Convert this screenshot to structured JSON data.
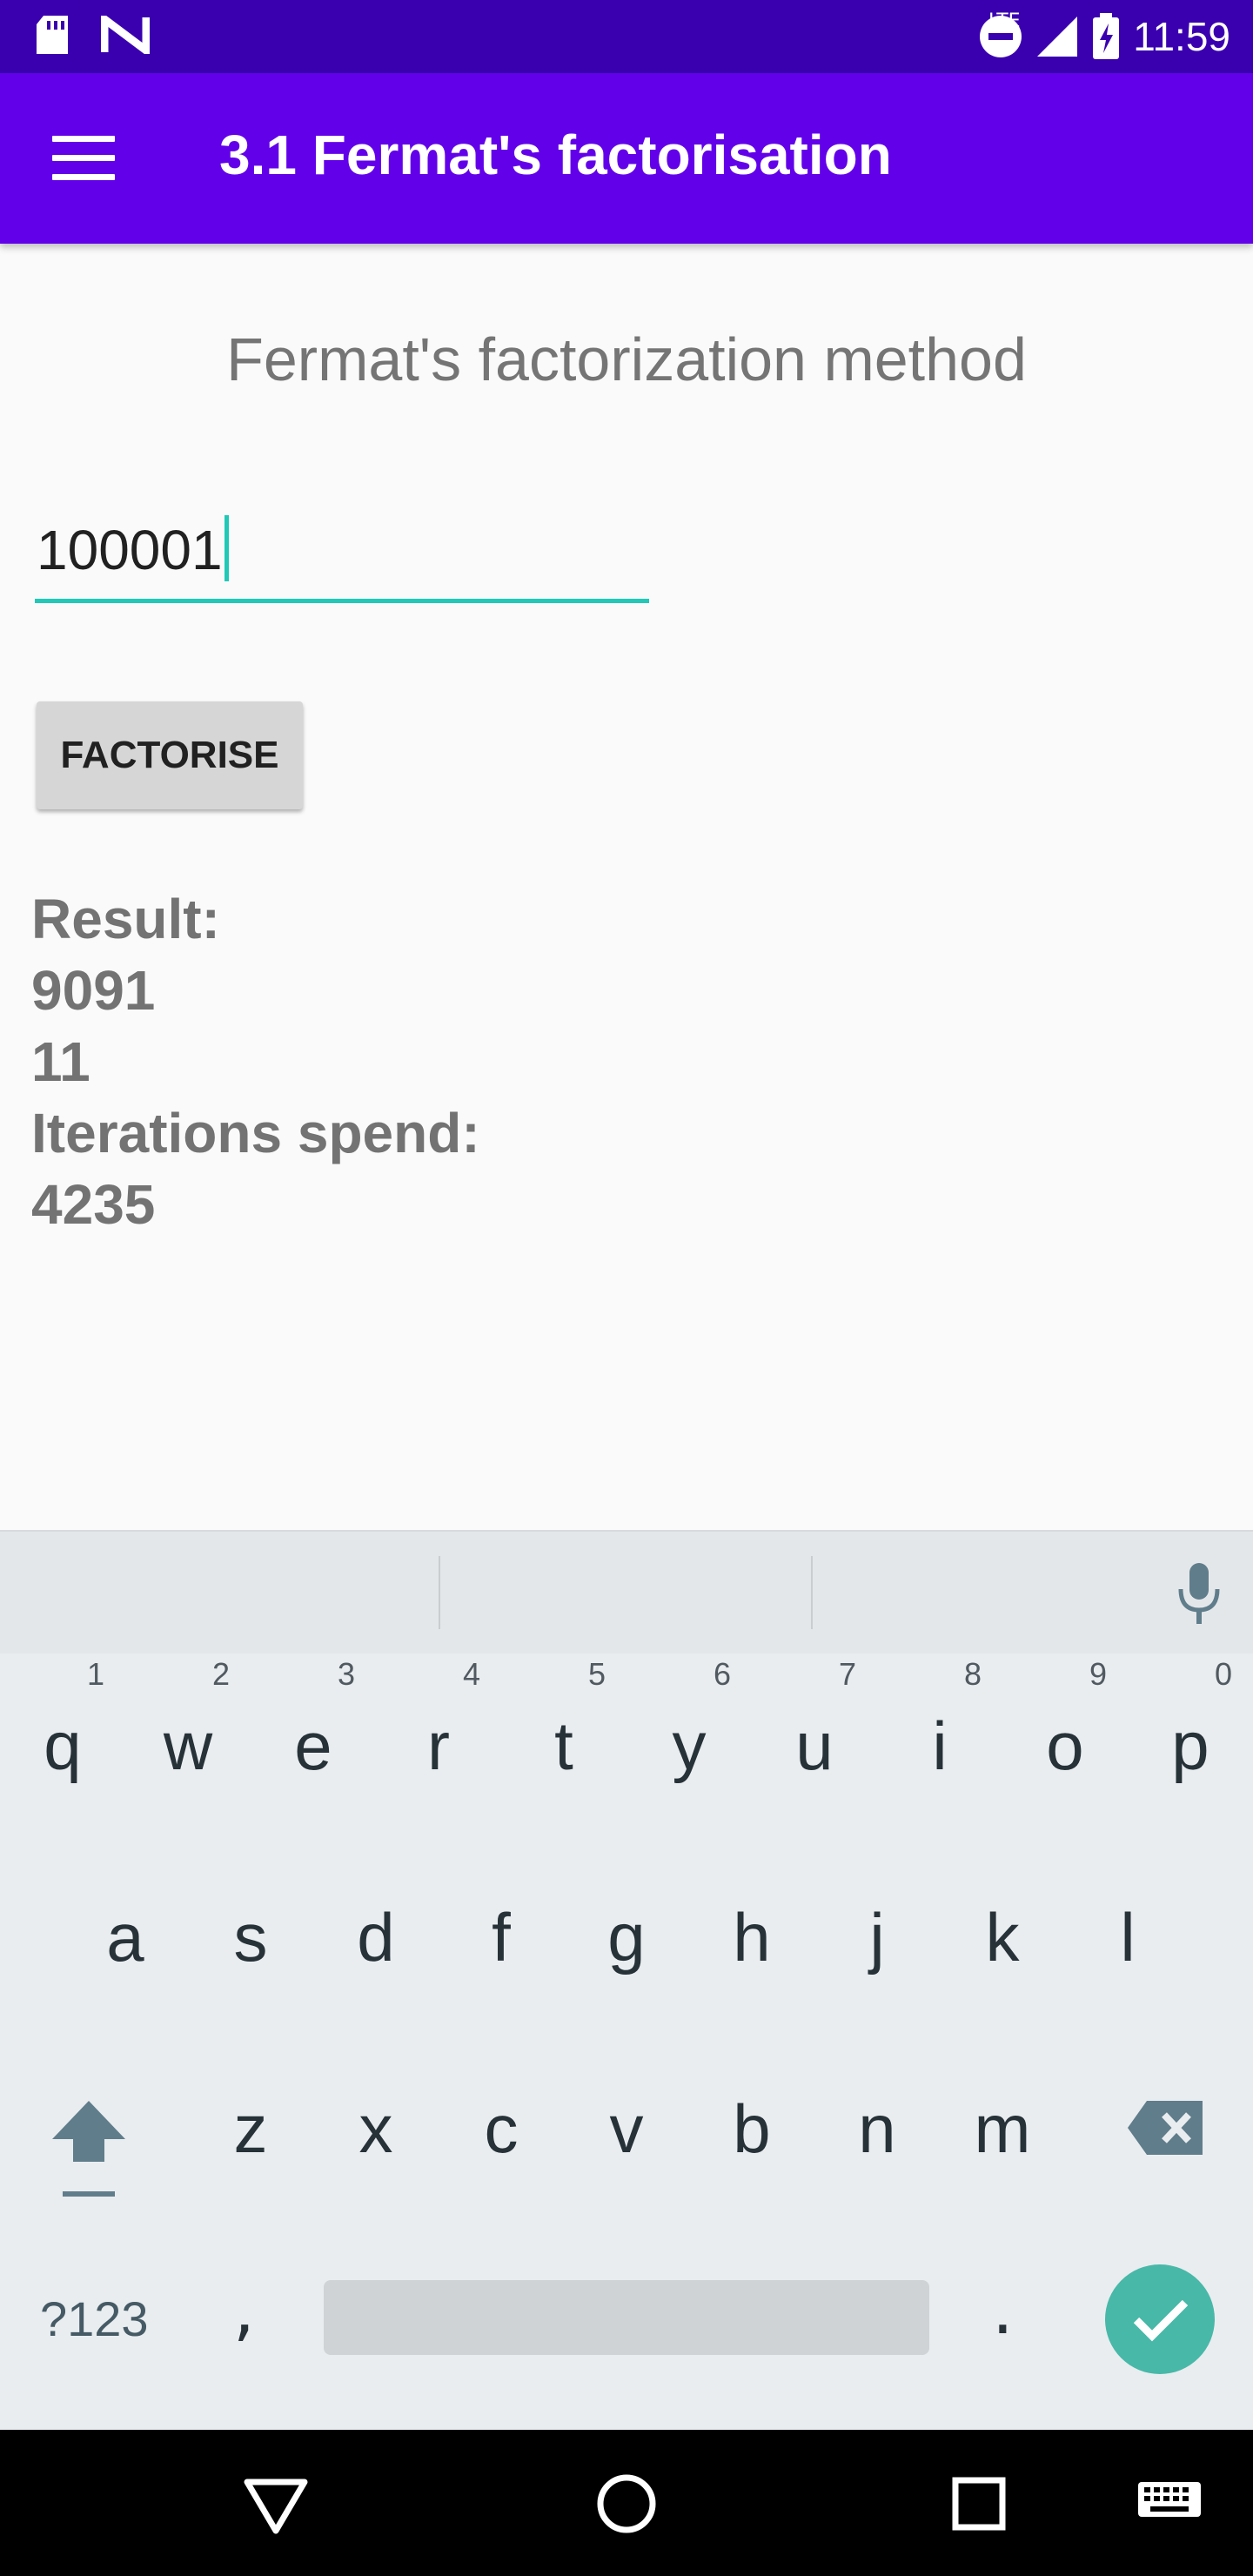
{
  "status_bar": {
    "time": "11:59",
    "network": "LTE",
    "icons": [
      "sd-card-icon",
      "n-notification-icon",
      "do-not-disturb-icon",
      "signal-icon",
      "battery-charging-icon"
    ]
  },
  "app_bar": {
    "title": "3.1 Fermat's factorisation",
    "background": "#6200ea"
  },
  "main": {
    "heading": "Fermat's factorization method",
    "input_value": "100001",
    "factorise_label": "FACTORISE",
    "result_label": "Result:",
    "factor_1": "9091",
    "factor_2": "11",
    "iterations_label": "Iterations spend:",
    "iterations_value": "4235"
  },
  "keyboard": {
    "row1": [
      {
        "k": "q",
        "n": "1"
      },
      {
        "k": "w",
        "n": "2"
      },
      {
        "k": "e",
        "n": "3"
      },
      {
        "k": "r",
        "n": "4"
      },
      {
        "k": "t",
        "n": "5"
      },
      {
        "k": "y",
        "n": "6"
      },
      {
        "k": "u",
        "n": "7"
      },
      {
        "k": "i",
        "n": "8"
      },
      {
        "k": "o",
        "n": "9"
      },
      {
        "k": "p",
        "n": "0"
      }
    ],
    "row2": [
      "a",
      "s",
      "d",
      "f",
      "g",
      "h",
      "j",
      "k",
      "l"
    ],
    "row3": [
      "z",
      "x",
      "c",
      "v",
      "b",
      "n",
      "m"
    ],
    "symbols_label": "?123",
    "comma": ",",
    "period": ".",
    "accent_color": "#48b8a8"
  }
}
